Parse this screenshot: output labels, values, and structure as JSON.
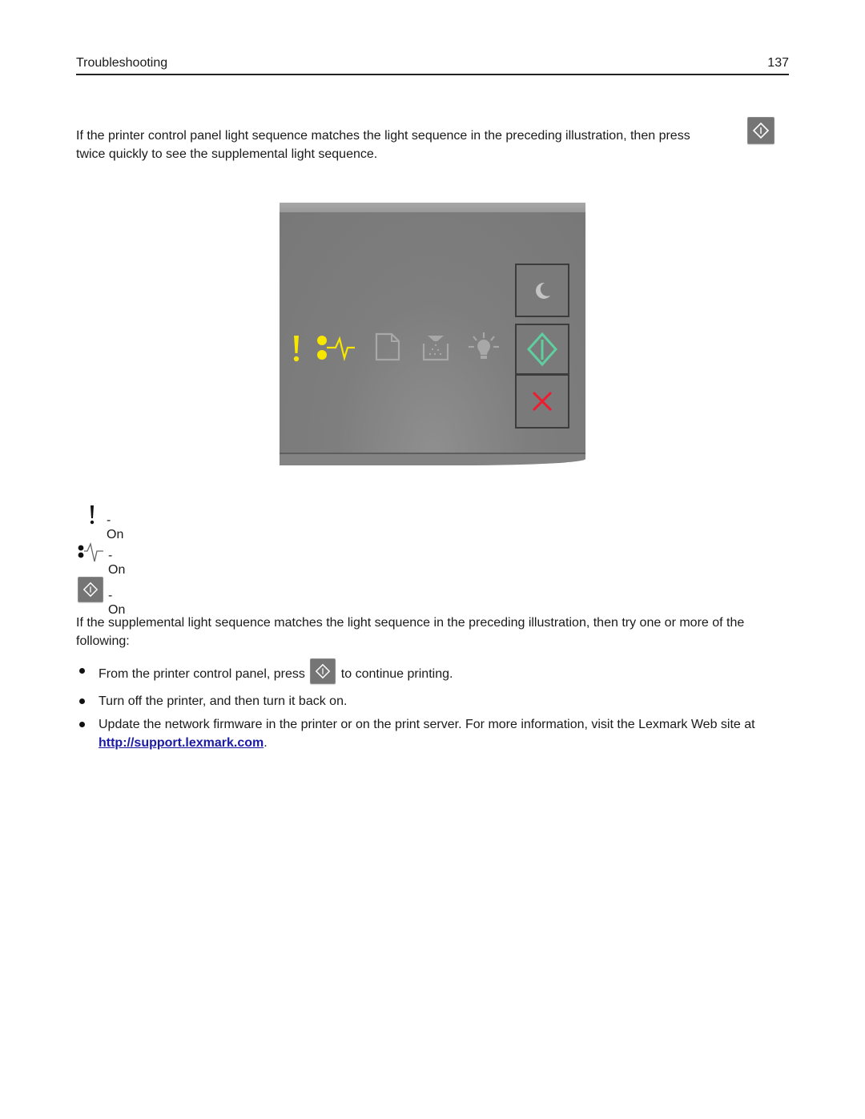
{
  "header": {
    "section_title": "Troubleshooting",
    "page_number": "137"
  },
  "intro": {
    "text_before_button": "If the printer control panel light sequence matches the light sequence in the preceding illustration, then press",
    "text_after_button": "twice quickly to see the supplemental light sequence.",
    "button_icon": "start-diamond-icon"
  },
  "control_panel": {
    "lights": [
      {
        "name": "error",
        "icon": "exclamation-icon",
        "state": "on",
        "color": "#f7e600"
      },
      {
        "name": "paper-jam",
        "icon": "paper-jam-icon",
        "state": "on",
        "color": "#f7e600"
      },
      {
        "name": "load-paper",
        "icon": "paper-sheet-icon",
        "state": "off",
        "color": "#a8a8a8"
      },
      {
        "name": "toner",
        "icon": "toner-icon",
        "state": "off",
        "color": "#a8a8a8"
      },
      {
        "name": "replace-drum",
        "icon": "lightbulb-icon",
        "state": "off",
        "color": "#a8a8a8"
      }
    ],
    "buttons": [
      {
        "name": "sleep",
        "icon": "moon-icon",
        "color": "#c4c4c4"
      },
      {
        "name": "start",
        "icon": "start-diamond-icon",
        "color": "#5fcf9f",
        "state": "on"
      },
      {
        "name": "stop",
        "icon": "stop-x-icon",
        "color": "#ee1c2e"
      }
    ]
  },
  "legend": [
    {
      "icon": "exclamation-icon",
      "label": "- On"
    },
    {
      "icon": "paper-jam-icon",
      "label": "- On"
    },
    {
      "icon": "start-diamond-icon",
      "label": "- On"
    }
  ],
  "followup": {
    "text": "If the supplemental light sequence matches the light sequence in the preceding illustration, then try one or more of the following:"
  },
  "bullets": [
    {
      "before": "From the printer control panel, press",
      "after": "to continue printing."
    },
    {
      "text": "Turn off the printer, and then turn it back on."
    },
    {
      "before": "Update the network firmware in the printer or on the print server. For more information, visit the Lexmark Web site at",
      "link": "http://support.lexmark.com",
      "after": "."
    }
  ],
  "colors": {
    "link": "#1a1aa6",
    "light_on": "#f7e600",
    "light_off": "#a8a8a8",
    "start_green": "#5fcf9f",
    "stop_red": "#ee1c2e"
  }
}
